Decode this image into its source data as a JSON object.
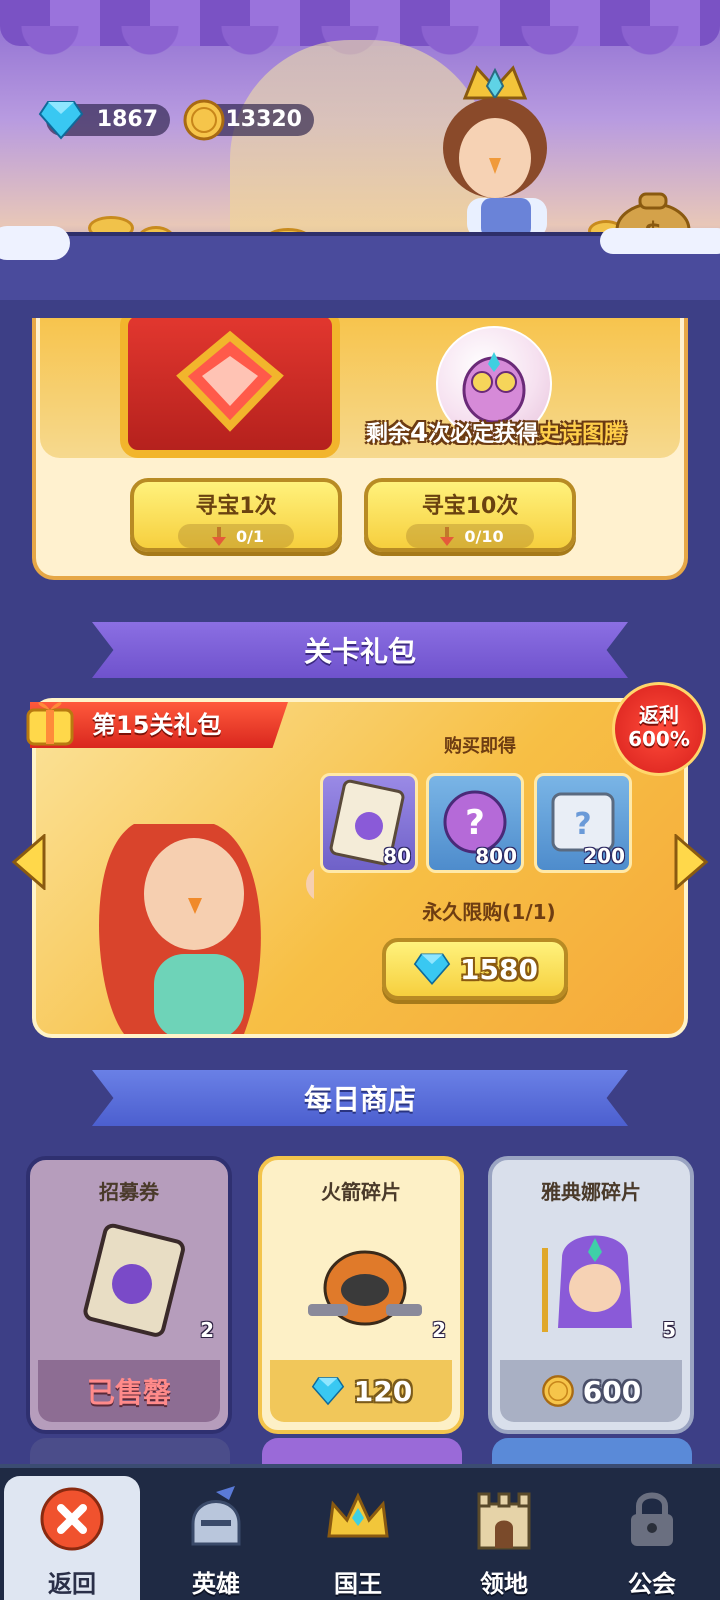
{
  "header": {
    "gems": "1867",
    "coins": "13320"
  },
  "treasure": {
    "hint_prefix": "剩余",
    "hint_count": "4",
    "hint_mid": "次必定获得",
    "hint_reward": "史诗图腾",
    "buttons": [
      {
        "label": "寻宝1次",
        "cost": "0/1"
      },
      {
        "label": "寻宝10次",
        "cost": "0/10"
      }
    ]
  },
  "level_pack": {
    "section_title": "关卡礼包",
    "tag": "第15关礼包",
    "rebate_line1": "返利",
    "rebate_line2": "600%",
    "buy_get_label": "购买即得",
    "items": [
      {
        "icon": "recruit-ticket-icon",
        "qty": "80"
      },
      {
        "icon": "mystery-orb-icon",
        "qty": "800"
      },
      {
        "icon": "mystery-scroll-icon",
        "qty": "200"
      }
    ],
    "limit_text": "永久限购(1/1)",
    "price": "1580"
  },
  "daily_shop": {
    "section_title": "每日商店",
    "cards": [
      {
        "title": "招募券",
        "count": "2",
        "footer": "已售罄",
        "state": "sold-out"
      },
      {
        "title": "火箭碎片",
        "count": "2",
        "price": "120",
        "currency": "gem"
      },
      {
        "title": "雅典娜碎片",
        "count": "5",
        "price": "600",
        "currency": "coin"
      }
    ]
  },
  "nav": {
    "items": [
      {
        "label": "返回",
        "icon": "close-icon",
        "active": true
      },
      {
        "label": "英雄",
        "icon": "helmet-icon"
      },
      {
        "label": "国王",
        "icon": "crown-icon"
      },
      {
        "label": "领地",
        "icon": "castle-icon"
      },
      {
        "label": "公会",
        "icon": "lock-icon"
      }
    ]
  },
  "colors": {
    "background": "#3d3f86",
    "gold_button": "#f6cf3e",
    "ribbon_purple": "#7a5ed8",
    "ribbon_blue": "#5a6edb",
    "rebate_red": "#e02b22"
  }
}
